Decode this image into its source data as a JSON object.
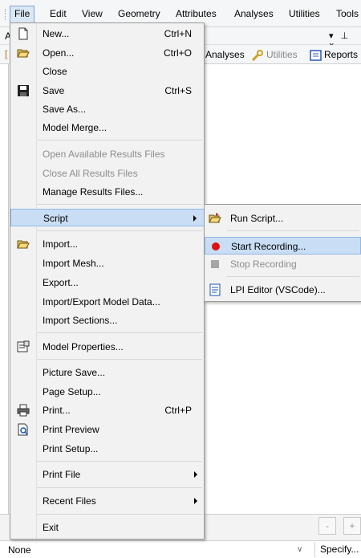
{
  "menubar": {
    "items": [
      {
        "label": "File",
        "active": true
      },
      {
        "label": "Edit"
      },
      {
        "label": "View"
      },
      {
        "label": "Geometry"
      },
      {
        "label": "Attributes"
      },
      {
        "label": "Analyses"
      },
      {
        "label": "Utilities"
      },
      {
        "label": "Tools"
      }
    ]
  },
  "panel": {
    "letter": "A",
    "controls": "▾ ⊥ ×"
  },
  "toolbar": {
    "letter": "[",
    "analyses": "Analyses",
    "utilities": "Utilities",
    "reports": "Reports"
  },
  "file_menu": {
    "items": [
      {
        "label": "New...",
        "shortcut": "Ctrl+N",
        "icon": "new-file-icon"
      },
      {
        "label": "Open...",
        "shortcut": "Ctrl+O",
        "icon": "open-folder-icon"
      },
      {
        "label": "Close"
      },
      {
        "label": "Save",
        "shortcut": "Ctrl+S",
        "icon": "save-disk-icon"
      },
      {
        "label": "Save As..."
      },
      {
        "label": "Model Merge..."
      },
      {
        "label": "Open Available Results Files",
        "disabled": true
      },
      {
        "label": "Close All Results Files",
        "disabled": true
      },
      {
        "label": "Manage Results Files..."
      },
      {
        "label": "Script",
        "submenu": true,
        "highlighted": true
      },
      {
        "label": "Import...",
        "icon": "import-folder-icon"
      },
      {
        "label": "Import Mesh..."
      },
      {
        "label": "Export..."
      },
      {
        "label": "Import/Export Model Data..."
      },
      {
        "label": "Import Sections..."
      },
      {
        "label": "Model Properties...",
        "icon": "model-properties-icon"
      },
      {
        "label": "Picture Save..."
      },
      {
        "label": "Page Setup..."
      },
      {
        "label": "Print...",
        "shortcut": "Ctrl+P",
        "icon": "printer-icon"
      },
      {
        "label": "Print Preview",
        "icon": "print-preview-icon"
      },
      {
        "label": "Print Setup..."
      },
      {
        "label": "Print File",
        "submenu": true
      },
      {
        "label": "Recent Files",
        "submenu": true
      },
      {
        "label": "Exit"
      }
    ]
  },
  "script_menu": {
    "items": [
      {
        "label": "Run Script...",
        "icon": "run-script-folder-icon"
      },
      {
        "label": "Start Recording...",
        "icon": "record-dot-icon",
        "highlighted": true
      },
      {
        "label": "Stop Recording",
        "icon": "stop-square-icon",
        "disabled": true
      },
      {
        "label": "LPI Editor (VSCode)...",
        "icon": "editor-icon"
      }
    ]
  },
  "statusbar": {
    "select_value": "None",
    "specify_label": "Specify...",
    "minus_label": "-",
    "plus_label": "+"
  },
  "colors": {
    "highlight": "#c9def5",
    "highlight_border": "#90b8e6",
    "record_red": "#e01010",
    "disabled_text": "#8d8d8d"
  }
}
